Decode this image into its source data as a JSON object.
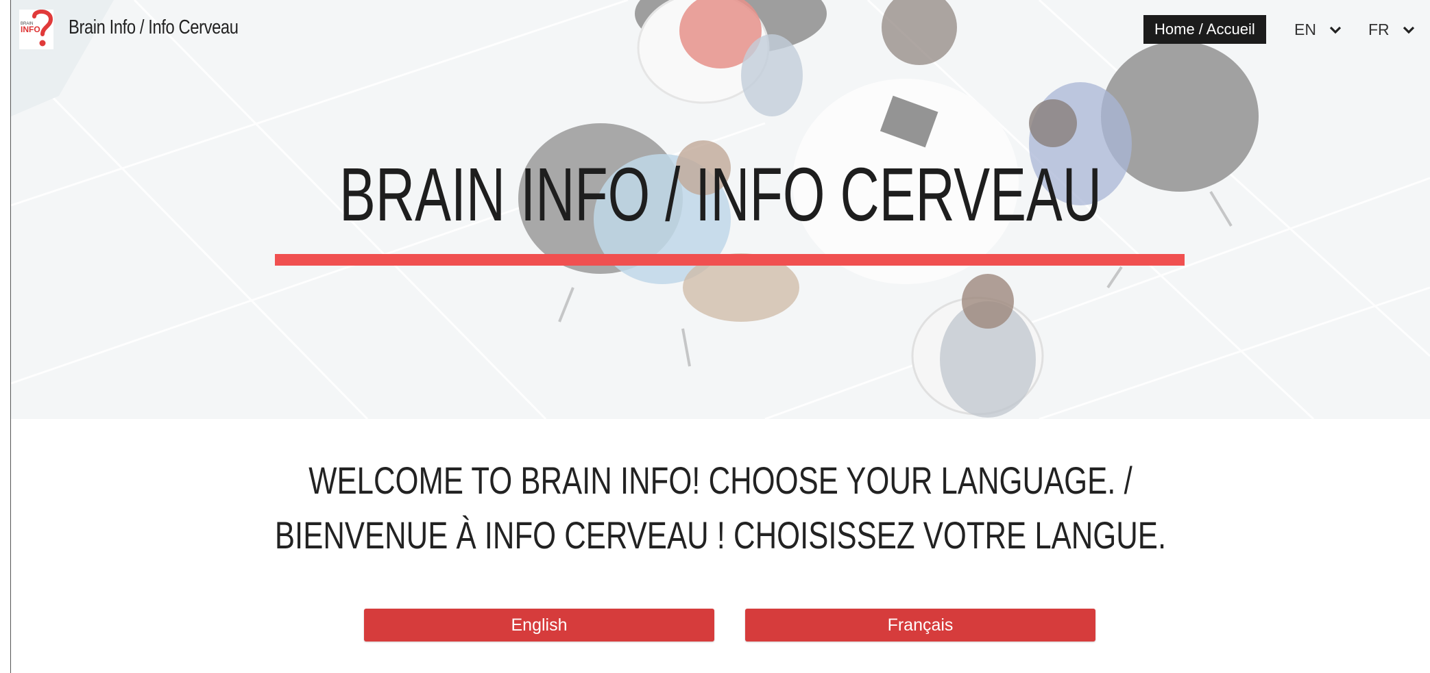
{
  "nav": {
    "brand": "Brain Info / Info Cerveau",
    "logo_text": "INFO",
    "logo_small": "BRAIN",
    "home_label": "Home / Accueil",
    "lang_en": "EN",
    "lang_fr": "FR"
  },
  "hero": {
    "title": "BRAIN INFO / INFO CERVEAU",
    "accent_color": "#f05050"
  },
  "welcome": {
    "line1": "WELCOME TO BRAIN INFO! CHOOSE YOUR LANGUAGE. /",
    "line2": "BIENVENUE À INFO CERVEAU ! CHOISISSEZ VOTRE LANGUE."
  },
  "buttons": {
    "english": "English",
    "french": "Français",
    "color": "#d63c3c"
  },
  "icons": {
    "logo": "brain-info-logo-icon",
    "chevron": "chevron-down-icon"
  }
}
